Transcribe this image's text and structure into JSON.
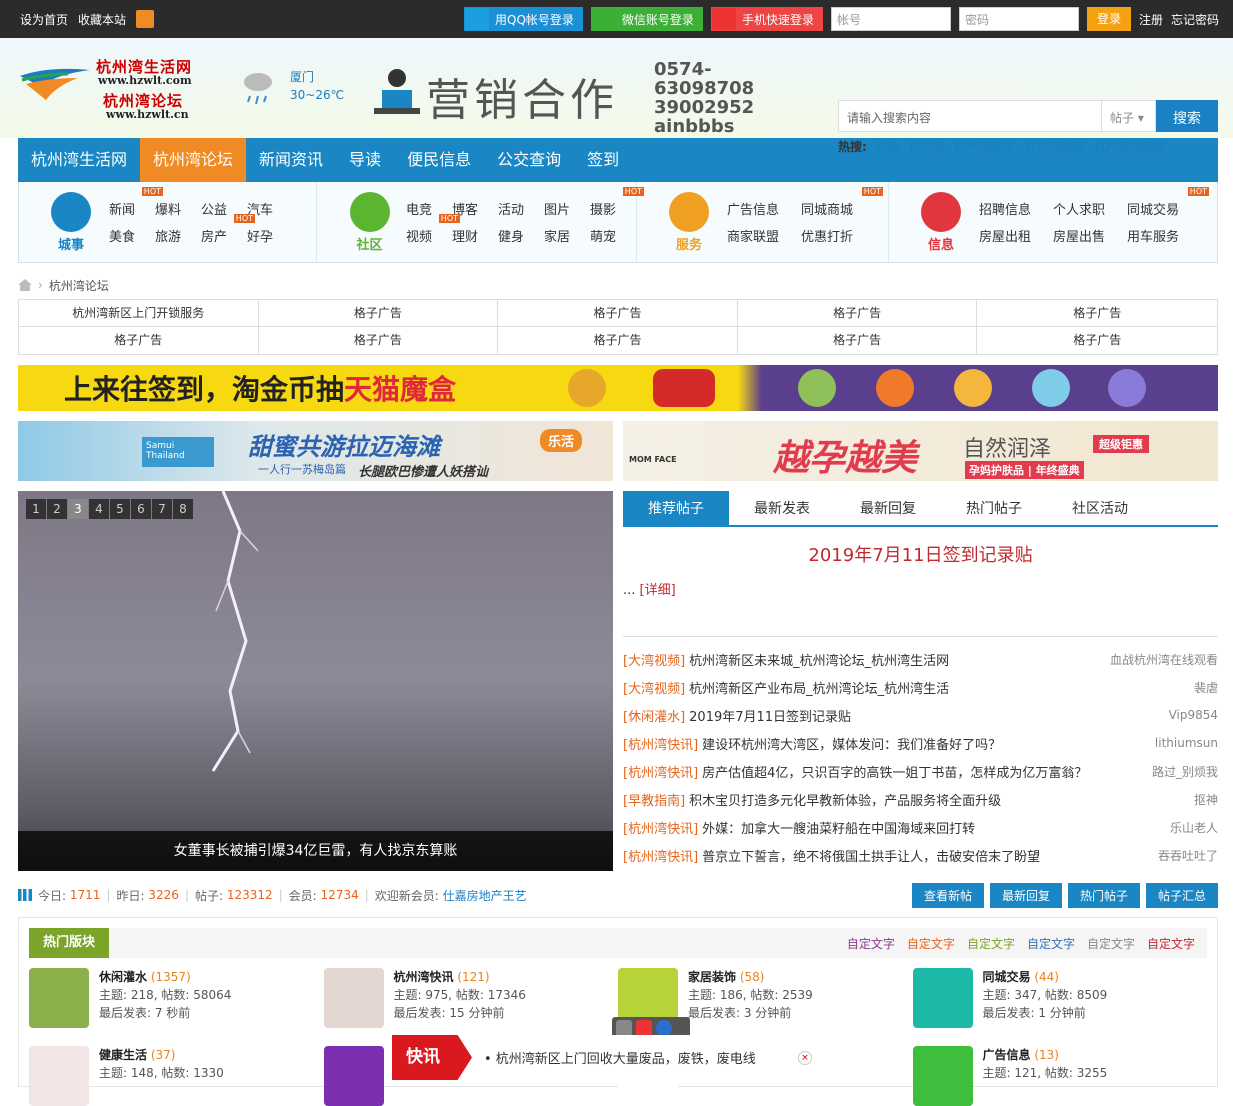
{
  "topbar": {
    "set_home": "设为首页",
    "bookmark": "收藏本站",
    "qq_login": "用QQ帐号登录",
    "wx_login": "微信账号登录",
    "phone_login": "手机快速登录",
    "account_placeholder": "帐号",
    "password_placeholder": "密码",
    "login": "登录",
    "register": "注册",
    "forgot": "忘记密码"
  },
  "logo": {
    "line1": "杭州湾生活网",
    "line2": "www.hzwlt.com",
    "line3": "杭州湾论坛",
    "line4": "www.hzwlt.cn"
  },
  "weather": {
    "city": "厦门",
    "temp": "30~26℃"
  },
  "header_ad": {
    "title": "营销合作",
    "phone1": "0574-63098708",
    "phone2": "39002952",
    "wechat": "ainbbbs"
  },
  "search": {
    "placeholder": "请输入搜索内容",
    "type": "帖子",
    "button": "搜索",
    "hot_label": "热搜:",
    "hot": [
      "活动",
      "杭州湾",
      "杭州湾新区",
      "杭州湾医院",
      "杭州湾世纪城"
    ]
  },
  "nav": [
    "杭州湾生活网",
    "杭州湾论坛",
    "新闻资讯",
    "导读",
    "便民信息",
    "公交查询",
    "签到"
  ],
  "subnav": [
    {
      "label": "城事",
      "color": "#1a87c4",
      "links": [
        "新闻",
        "爆料",
        "公益",
        "汽车",
        "美食",
        "旅游",
        "房产",
        "好孕"
      ]
    },
    {
      "label": "社区",
      "color": "#5bb531",
      "links": [
        "电竞",
        "博客",
        "活动",
        "图片",
        "摄影",
        "视频",
        "理财",
        "健身",
        "家居",
        "萌宠"
      ]
    },
    {
      "label": "服务",
      "color": "#f0a020",
      "links": [
        "广告信息",
        "同城商城",
        "商家联盟",
        "优惠打折"
      ]
    },
    {
      "label": "信息",
      "color": "#e0373f",
      "links": [
        "招聘信息",
        "个人求职",
        "同城交易",
        "房屋出租",
        "房屋出售",
        "用车服务"
      ]
    }
  ],
  "hot_tag": "HOT",
  "breadcrumb": "杭州湾论坛",
  "ad_grid": [
    "杭州湾新区上门开锁服务",
    "格子广告",
    "格子广告",
    "格子广告",
    "格子广告",
    "格子广告",
    "格子广告",
    "格子广告",
    "格子广告",
    "格子广告"
  ],
  "banner": {
    "text1": "上来往签到，淘金币抽",
    "text2": "天猫魔盒"
  },
  "ads": {
    "left_main": "甜蜜共游拉迈海滩",
    "left_sub1": "一人行一苏梅岛篇",
    "left_sub2": "长腿欧巴惨遭人妖搭讪",
    "left_tag": "乐活",
    "left_brand": "Samui Thailand",
    "right_brand": "MOM FACE",
    "right_main": "越孕越美",
    "right_sub": "自然润泽",
    "right_tag1": "孕妈护肤品",
    "right_tag2": "年终盛典",
    "right_badge": "超级钜惠"
  },
  "slider": {
    "pages": [
      "1",
      "2",
      "3",
      "4",
      "5",
      "6",
      "7",
      "8"
    ],
    "active": 3,
    "caption": "女董事长被捕引爆34亿巨雷，有人找京东算账"
  },
  "tabs": [
    "推荐帖子",
    "最新发表",
    "最新回复",
    "热门帖子",
    "社区活动"
  ],
  "featured": {
    "title": "2019年7月11日签到记录贴",
    "detail_prefix": "...",
    "detail_link": "[详细]"
  },
  "threads": [
    {
      "cat": "[大湾视频]",
      "title": "杭州湾新区未来城_杭州湾论坛_杭州湾生活网",
      "user": "血战杭州湾在线观看"
    },
    {
      "cat": "[大湾视频]",
      "title": "杭州湾新区产业布局_杭州湾论坛_杭州湾生活",
      "user": "裴虐"
    },
    {
      "cat": "[休闲灌水]",
      "title": "2019年7月11日签到记录贴",
      "user": "Vip9854"
    },
    {
      "cat": "[杭州湾快讯]",
      "title": "建设环杭州湾大湾区，媒体发问：我们准备好了吗？",
      "user": "lithiumsun"
    },
    {
      "cat": "[杭州湾快讯]",
      "title": "房产估值超4亿，只识百字的高铁一姐丁书苗，怎样成为亿万富翁？",
      "user": "路过_别烦我"
    },
    {
      "cat": "[早教指南]",
      "title": "积木宝贝打造多元化早教新体验，产品服务将全面升级",
      "user": "抠神"
    },
    {
      "cat": "[杭州湾快讯]",
      "title": "外媒：加拿大一艘油菜籽船在中国海域来回打转",
      "user": "乐山老人"
    },
    {
      "cat": "[杭州湾快讯]",
      "title": "普京立下誓言，绝不将俄国土拱手让人，击破安倍末了盼望",
      "user": "吞吞吐吐了"
    }
  ],
  "stats": {
    "today_label": "今日:",
    "today": "1711",
    "yesterday_label": "昨日:",
    "yesterday": "3226",
    "posts_label": "帖子:",
    "posts": "123312",
    "members_label": "会员:",
    "members": "12734",
    "welcome_label": "欢迎新会员:",
    "new_member": "仕嘉房地产王艺",
    "buttons": [
      "查看新帖",
      "最新回复",
      "热门帖子",
      "帖子汇总"
    ]
  },
  "hot_forums": {
    "title": "热门版块",
    "custom_words": [
      {
        "t": "自定文字",
        "c": "#8a3b8f"
      },
      {
        "t": "自定文字",
        "c": "#e6641d"
      },
      {
        "t": "自定文字",
        "c": "#7ba428"
      },
      {
        "t": "自定文字",
        "c": "#3b6fb6"
      },
      {
        "t": "自定文字",
        "c": "#888888"
      },
      {
        "t": "自定文字",
        "c": "#c0292f"
      }
    ],
    "items": [
      {
        "name": "休闲灌水",
        "count": "(1357)",
        "stats": "主题: 218, 帖数: 58064",
        "last": "最后发表: 7 秒前",
        "color": "#8bb04a"
      },
      {
        "name": "杭州湾快讯",
        "count": "(121)",
        "stats": "主题: 975, 帖数: 17346",
        "last": "最后发表: 15 分钟前",
        "color": "#e4d6d0"
      },
      {
        "name": "家居装饰",
        "count": "(58)",
        "stats": "主题: 186, 帖数: 2539",
        "last": "最后发表: 3 分钟前",
        "color": "#b6d43a"
      },
      {
        "name": "同城交易",
        "count": "(44)",
        "stats": "主题: 347, 帖数: 8509",
        "last": "最后发表: 1 分钟前",
        "color": "#1cb8a8"
      },
      {
        "name": "健康生活",
        "count": "(37)",
        "stats": "主题: 148, 帖数: 1330",
        "last": "",
        "color": "#f1e5e5"
      },
      {
        "name": "",
        "count": "",
        "stats": "",
        "last": "",
        "color": "#7a2fb0"
      },
      {
        "name": "",
        "count": "",
        "stats": "",
        "last": "",
        "color": "#ffffff"
      },
      {
        "name": "广告信息",
        "count": "(13)",
        "stats": "主题: 121, 帖数: 3255",
        "last": "",
        "color": "#3dbf3d"
      }
    ]
  },
  "news_flash": {
    "label": "快讯",
    "text": "• 杭州湾新区上门回收大量废品，废铁，废电线",
    "close": "×"
  }
}
